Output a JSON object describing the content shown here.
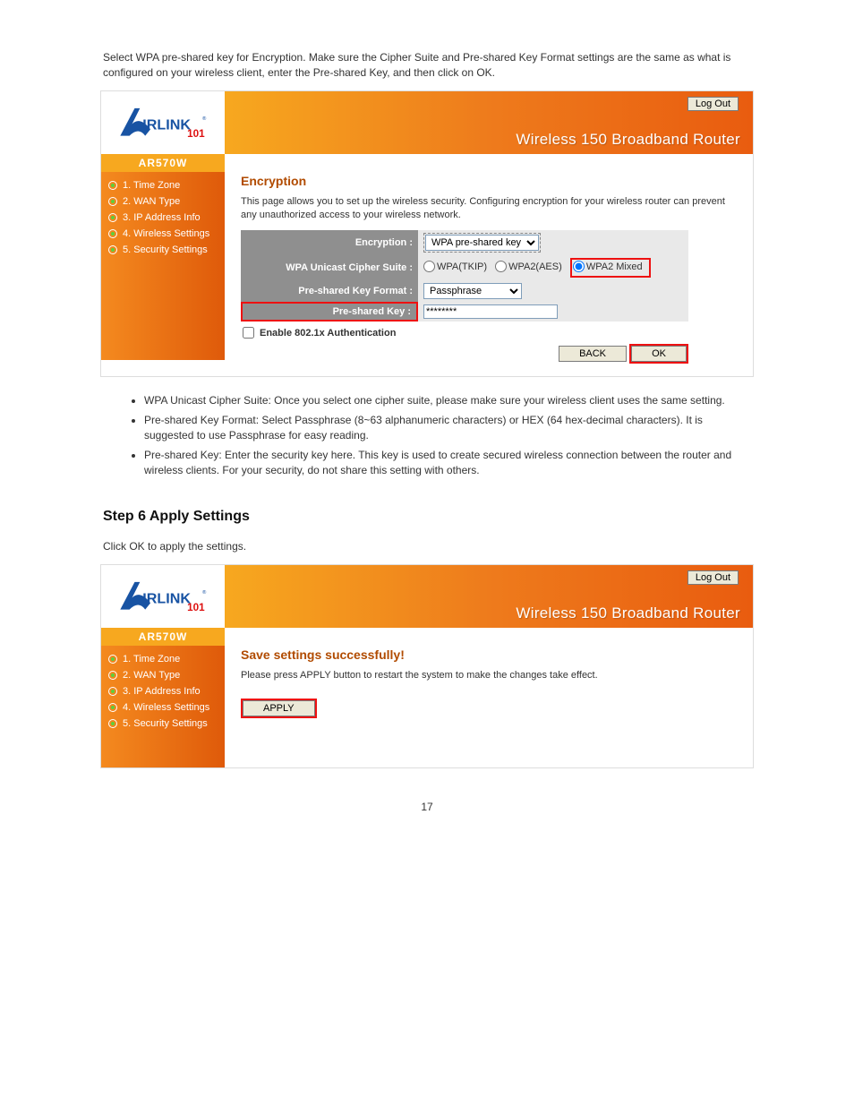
{
  "intro_paragraph": "Select WPA pre-shared key for Encryption. Make sure the Cipher Suite and Pre-shared Key Format settings are the same as what is configured on your wireless client, enter the Pre-shared Key, and then click on OK.",
  "logout_label": "Log Out",
  "brand_title": "Wireless 150 Broadband Router",
  "model": "AR570W",
  "sidebar": {
    "items": [
      {
        "label": "1. Time Zone"
      },
      {
        "label": "2. WAN Type"
      },
      {
        "label": "3. IP Address Info"
      },
      {
        "label": "4. Wireless Settings"
      },
      {
        "label": "5. Security Settings"
      }
    ]
  },
  "screen1": {
    "heading": "Encryption",
    "desc": "This page allows you to set up the wireless security. Configuring encryption for your wireless router can prevent any unauthorized access to your wireless network.",
    "rows": {
      "encryption_label": "Encryption :",
      "encryption_value": "WPA pre-shared key",
      "cipher_label": "WPA Unicast Cipher Suite :",
      "cipher_opts": {
        "tkip": "WPA(TKIP)",
        "aes": "WPA2(AES)",
        "mixed": "WPA2 Mixed"
      },
      "format_label": "Pre-shared Key Format :",
      "format_value": "Passphrase",
      "key_label": "Pre-shared Key :",
      "key_value": "********"
    },
    "enable_8021x_label": "Enable 802.1x Authentication",
    "back_label": "BACK",
    "ok_label": "OK"
  },
  "bullets_text": [
    "WPA Unicast Cipher Suite: Once you select one cipher suite, please make sure your wireless client uses the same setting.",
    "Pre-shared Key Format: Select Passphrase (8~63 alphanumeric characters) or HEX (64 hex-decimal characters). It is suggested to use Passphrase for easy reading.",
    "Pre-shared Key: Enter the security key here. This key is used to create secured wireless connection between the router and wireless clients. For your security, do not share this setting with others."
  ],
  "step6_title": "Step 6 Apply Settings",
  "step6_text": "Click OK to apply the settings.",
  "screen2": {
    "heading": "Save settings successfully!",
    "desc": "Please press APPLY button to restart the system to make the changes take effect.",
    "apply_label": "APPLY"
  },
  "page_number": "17"
}
